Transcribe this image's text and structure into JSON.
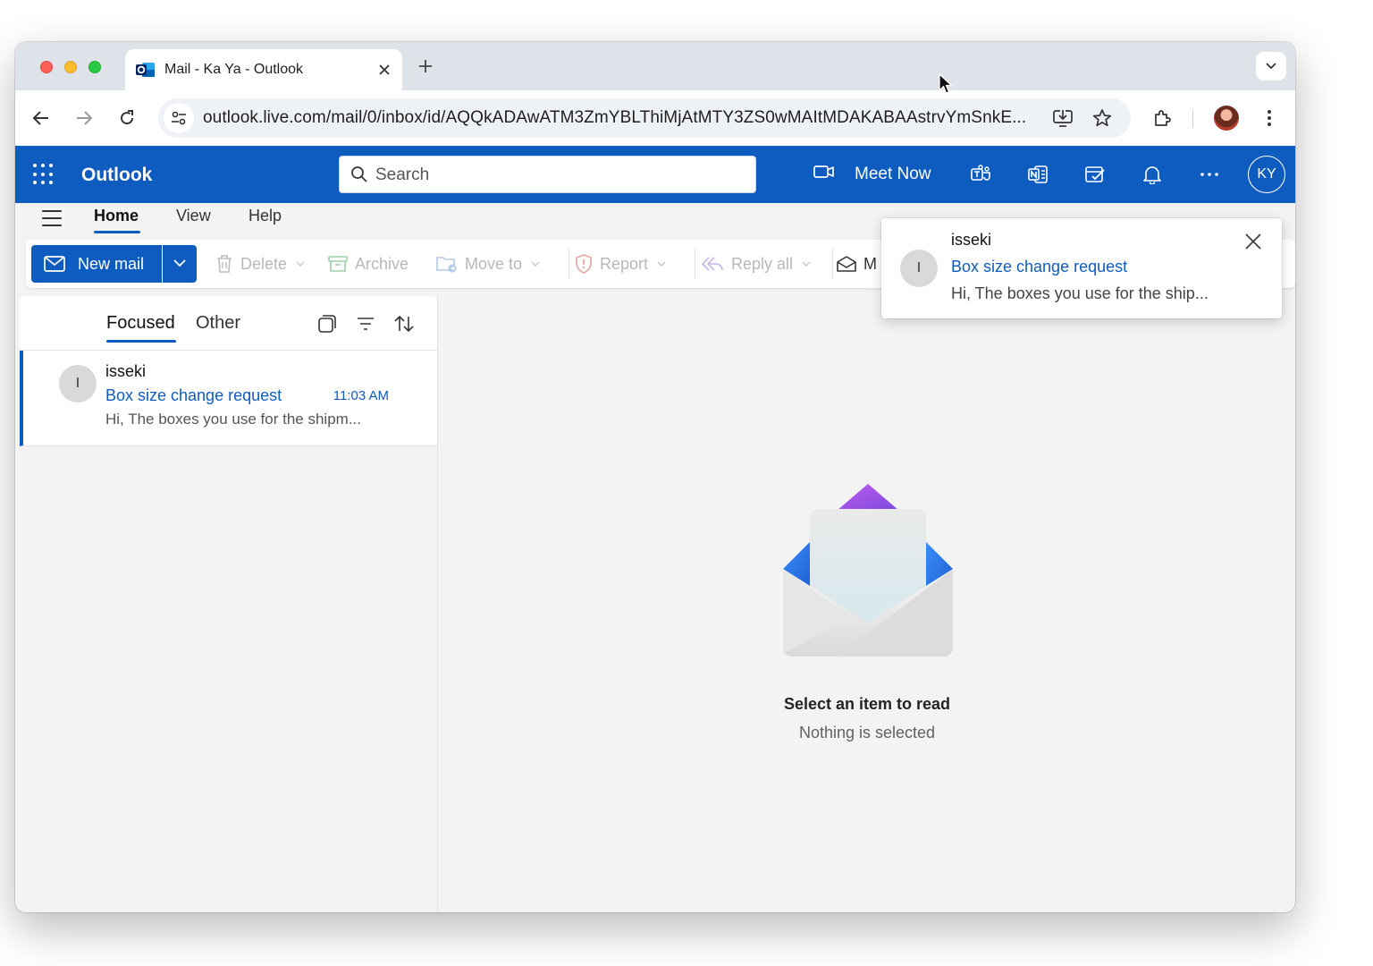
{
  "browser": {
    "tab_title": "Mail - Ka Ya - Outlook",
    "url": "outlook.live.com/mail/0/inbox/id/AQQkADAwATM3ZmYBLThiMjAtMTY3ZS0wMAItMDAKABAAstrvYmSnkE..."
  },
  "outlook": {
    "brand": "Outlook",
    "search_placeholder": "Search",
    "meet_now": "Meet Now",
    "user_initials": "KY",
    "brand_color": "#0f5cc0"
  },
  "ribbon": {
    "tabs": [
      "Home",
      "View",
      "Help"
    ],
    "active_tab": "Home",
    "new_mail": "New mail",
    "delete": "Delete",
    "archive": "Archive",
    "move_to": "Move to",
    "report": "Report",
    "reply_all": "Reply all",
    "mark_partial": "M"
  },
  "message_list": {
    "pivots": [
      "Focused",
      "Other"
    ],
    "active_pivot": "Focused",
    "items": [
      {
        "initial": "I",
        "sender": "isseki",
        "subject": "Box size change request",
        "time": "11:03 AM",
        "preview": "Hi, The boxes you use for the shipm..."
      }
    ]
  },
  "reading_pane": {
    "title": "Select an item to read",
    "subtitle": "Nothing is selected"
  },
  "notification": {
    "initial": "I",
    "sender": "isseki",
    "subject": "Box size change request",
    "preview": "Hi, The boxes you use for the ship..."
  },
  "icons": {
    "tab_favicon": "outlook-logo-icon",
    "tab_close": "close-icon",
    "new_tab": "plus-icon",
    "tab_search": "chevron-down-icon",
    "back": "arrow-left-icon",
    "forward": "arrow-right-icon",
    "reload": "reload-icon",
    "site_info": "tune-icon",
    "install": "install-app-icon",
    "bookmark": "star-icon",
    "extensions": "puzzle-icon",
    "menu": "kebab-menu-icon"
  }
}
